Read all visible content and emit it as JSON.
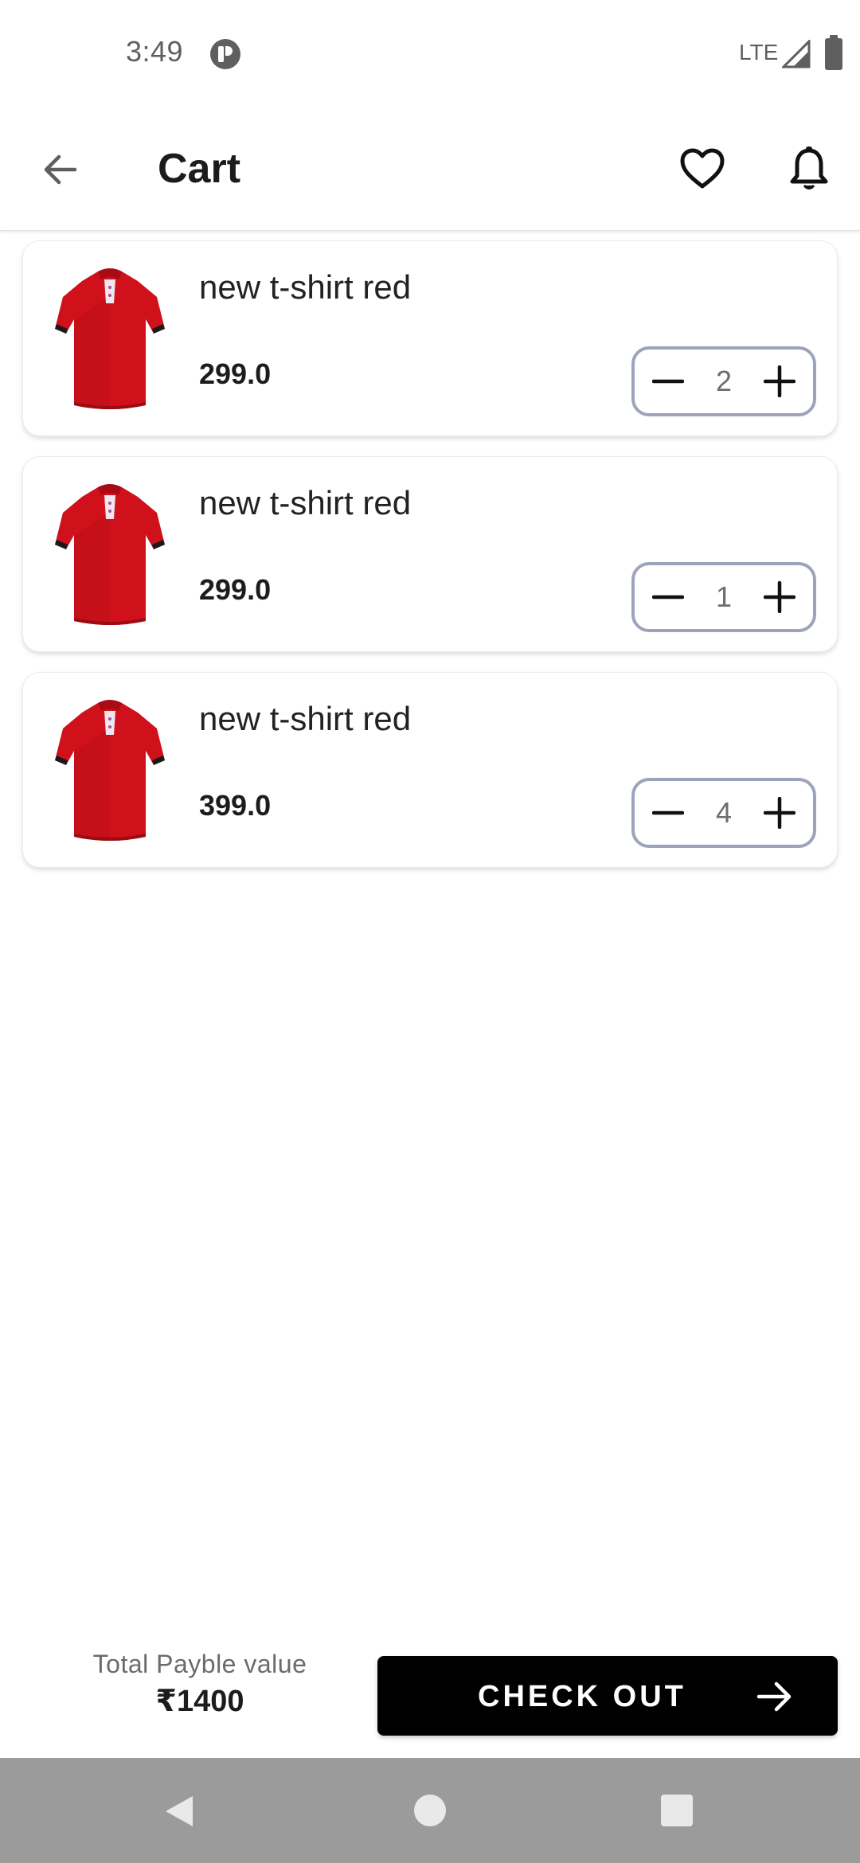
{
  "status_bar": {
    "time": "3:49",
    "network": "LTE",
    "app_icon": "pocket-casts-icon",
    "signal_icon": "signal-icon",
    "battery_icon": "battery-icon"
  },
  "app_bar": {
    "title": "Cart",
    "back_icon": "arrow-left-icon",
    "favorite_icon": "heart-icon",
    "notification_icon": "bell-icon"
  },
  "cart": {
    "items": [
      {
        "name": "new t-shirt red",
        "price": "299.0",
        "quantity": "2",
        "image": "red-tshirt-image"
      },
      {
        "name": "new t-shirt red",
        "price": "299.0",
        "quantity": "1",
        "image": "red-tshirt-image"
      },
      {
        "name": "new t-shirt red",
        "price": "399.0",
        "quantity": "4",
        "image": "red-tshirt-image"
      }
    ],
    "decrement_icon": "minus-icon",
    "increment_icon": "plus-icon"
  },
  "checkout": {
    "total_label": "Total Payble value",
    "total_value": "₹1400",
    "button_label": "CHECK OUT",
    "button_icon": "arrow-right-icon"
  },
  "nav_bar": {
    "back_icon": "nav-back-icon",
    "home_icon": "nav-home-icon",
    "recents_icon": "nav-recents-icon"
  },
  "colors": {
    "accent": "#000000",
    "stepper_border": "#9ea3bc",
    "product_red": "#d0111b",
    "nav_bar": "#9b9b9b"
  }
}
